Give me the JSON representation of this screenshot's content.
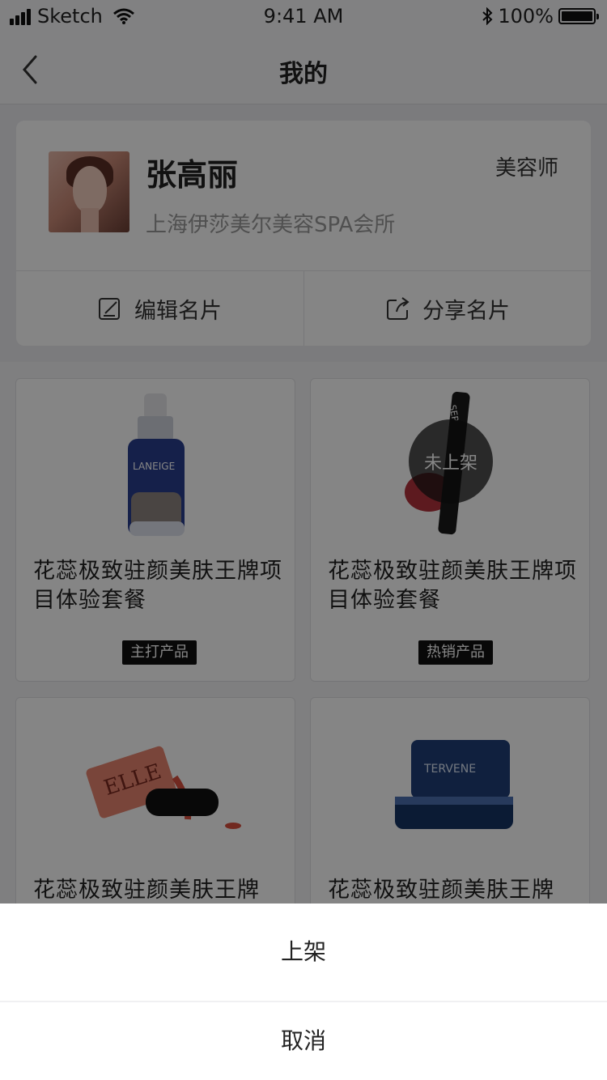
{
  "status_bar": {
    "carrier": "Sketch",
    "time": "9:41 AM",
    "battery": "100%"
  },
  "nav": {
    "title": "我的"
  },
  "profile": {
    "name": "张高丽",
    "role": "美容师",
    "company": "上海伊莎美尔美容SPA会所",
    "edit_label": "编辑名片",
    "share_label": "分享名片"
  },
  "products": [
    {
      "title": "花蕊极致驻颜美肤王牌项目体验套餐",
      "badge": "主打产品",
      "image": "serum-bottle-image"
    },
    {
      "title": "花蕊极致驻颜美肤王牌项目体验套餐",
      "badge": "热销产品",
      "image": "lipstick-image",
      "overlay": "未上架"
    },
    {
      "title": "花蕊极致驻颜美肤王牌",
      "image": "nail-polish-image"
    },
    {
      "title": "花蕊极致驻颜美肤王牌",
      "image": "night-cream-jar-image"
    }
  ],
  "action_sheet": {
    "primary": "上架",
    "cancel": "取消"
  }
}
